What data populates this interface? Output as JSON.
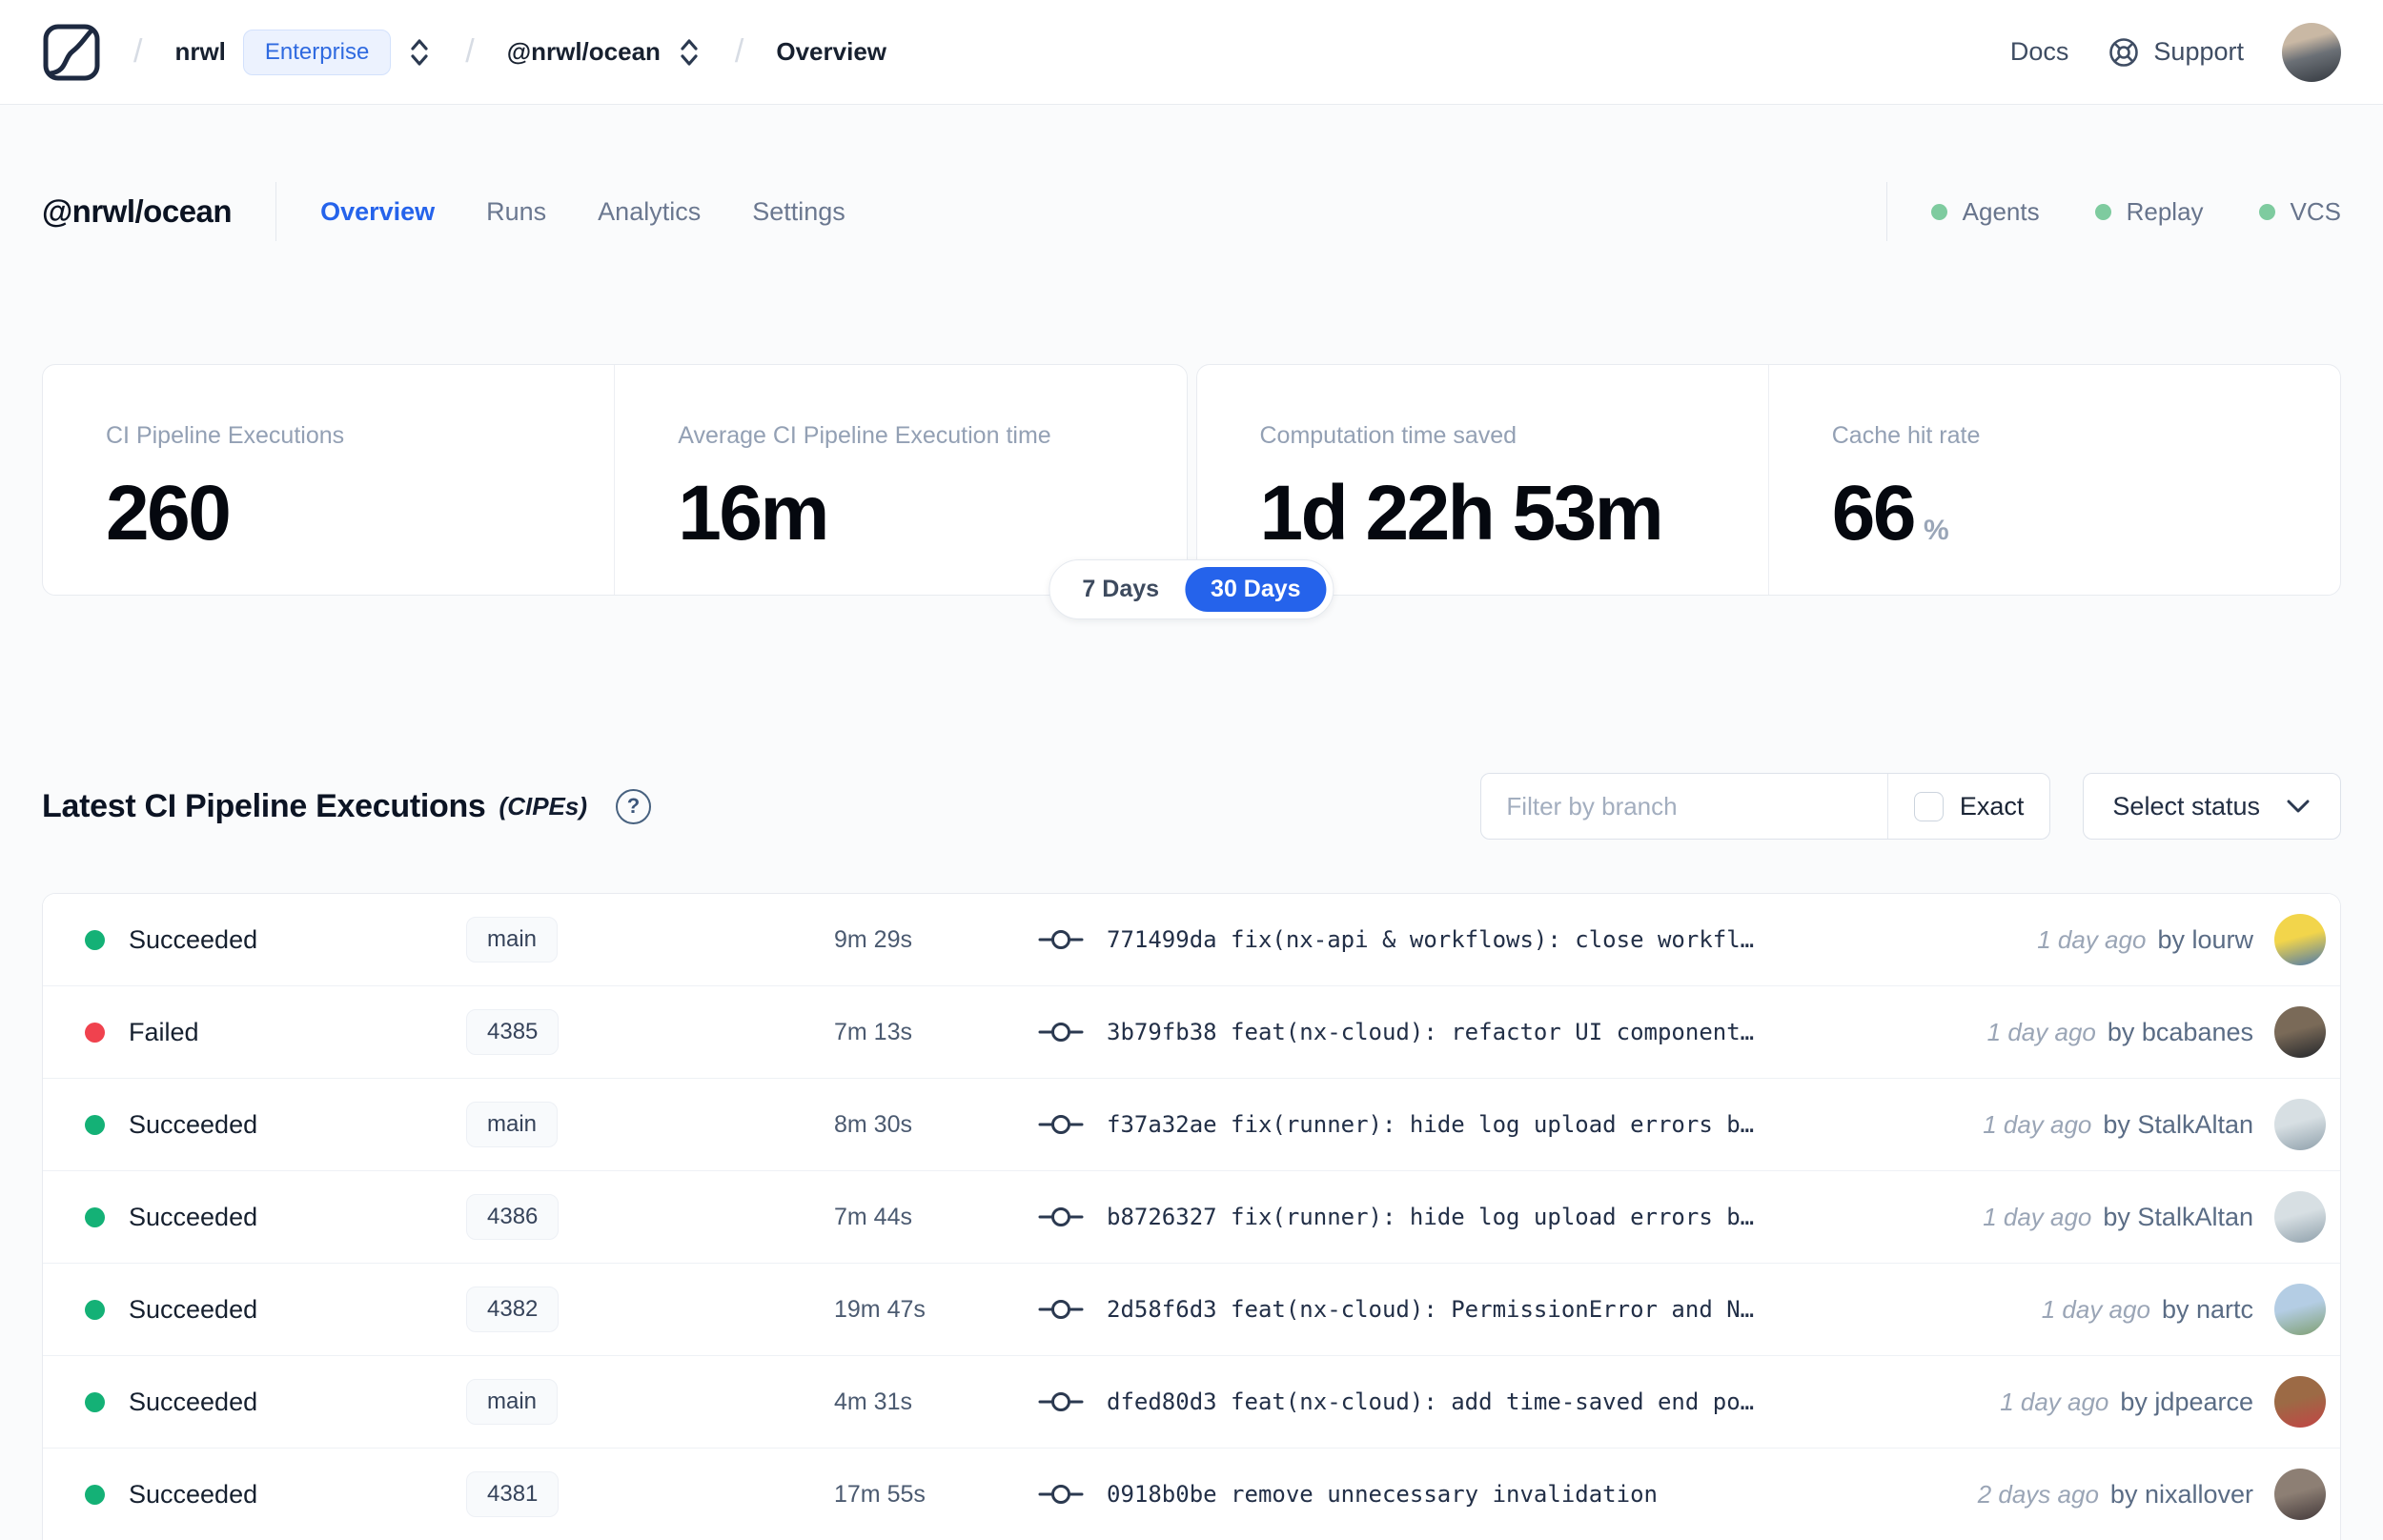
{
  "colors": {
    "accent_blue": "#2563eb",
    "status": {
      "succeeded": "#14b176",
      "failed": "#f0424e"
    },
    "integration_green": "#7ecb9f"
  },
  "topnav": {
    "breadcrumb": {
      "separator": "/",
      "org": "nrwl",
      "org_badge": "Enterprise",
      "workspace": "@nrwl/ocean",
      "page": "Overview"
    },
    "docs_label": "Docs",
    "support_label": "Support"
  },
  "header": {
    "title": "@nrwl/ocean",
    "tabs": [
      {
        "label": "Overview",
        "active": true
      },
      {
        "label": "Runs",
        "active": false
      },
      {
        "label": "Analytics",
        "active": false
      },
      {
        "label": "Settings",
        "active": false
      }
    ],
    "integrations": [
      "Agents",
      "Replay",
      "VCS"
    ]
  },
  "stats": {
    "cards": [
      {
        "label": "CI Pipeline Executions",
        "value": "260"
      },
      {
        "label": "Average CI Pipeline Execution time",
        "value": "16m"
      },
      {
        "label": "Computation time saved",
        "value": "1d 22h 53m"
      },
      {
        "label": "Cache hit rate",
        "value": "66",
        "suffix": "%"
      }
    ],
    "range_toggle": {
      "options": [
        "7 Days",
        "30 Days"
      ],
      "active": "30 Days"
    }
  },
  "cipe_section": {
    "title": "Latest CI Pipeline Executions",
    "title_suffix": "(CIPEs)",
    "help_glyph": "?",
    "filter_placeholder": "Filter by branch",
    "exact_label": "Exact",
    "status_dropdown_label": "Select status"
  },
  "table": {
    "rows": [
      {
        "status": "Succeeded",
        "branch": "main",
        "duration": "9m 29s",
        "commit": "771499da fix(nx-api & workflows): close workfl…",
        "time_ago": "1 day ago",
        "author": "by lourw",
        "avatar_colors": [
          "#f2d54b",
          "#4d79ab"
        ]
      },
      {
        "status": "Failed",
        "branch": "4385",
        "duration": "7m 13s",
        "commit": "3b79fb38 feat(nx-cloud): refactor UI component…",
        "time_ago": "1 day ago",
        "author": "by bcabanes",
        "avatar_colors": [
          "#7a6a58",
          "#23262b"
        ]
      },
      {
        "status": "Succeeded",
        "branch": "main",
        "duration": "8m 30s",
        "commit": "f37a32ae fix(runner): hide log upload errors b…",
        "time_ago": "1 day ago",
        "author": "by StalkAltan",
        "avatar_colors": [
          "#d7dfe3",
          "#8fa0ab"
        ]
      },
      {
        "status": "Succeeded",
        "branch": "4386",
        "duration": "7m 44s",
        "commit": "b8726327 fix(runner): hide log upload errors b…",
        "time_ago": "1 day ago",
        "author": "by StalkAltan",
        "avatar_colors": [
          "#d7dfe3",
          "#8fa0ab"
        ]
      },
      {
        "status": "Succeeded",
        "branch": "4382",
        "duration": "19m 47s",
        "commit": "2d58f6d3 feat(nx-cloud): PermissionError and N…",
        "time_ago": "1 day ago",
        "author": "by nartc",
        "avatar_colors": [
          "#b4cde4",
          "#7f9f72"
        ]
      },
      {
        "status": "Succeeded",
        "branch": "main",
        "duration": "4m 31s",
        "commit": "dfed80d3 feat(nx-cloud): add time-saved end po…",
        "time_ago": "1 day ago",
        "author": "by jdpearce",
        "avatar_colors": [
          "#9c6a45",
          "#c24545"
        ]
      },
      {
        "status": "Succeeded",
        "branch": "4381",
        "duration": "17m 55s",
        "commit": "0918b0be remove unnecessary invalidation",
        "time_ago": "2 days ago",
        "author": "by nixallover",
        "avatar_colors": [
          "#8d7f74",
          "#43393a"
        ]
      }
    ]
  }
}
